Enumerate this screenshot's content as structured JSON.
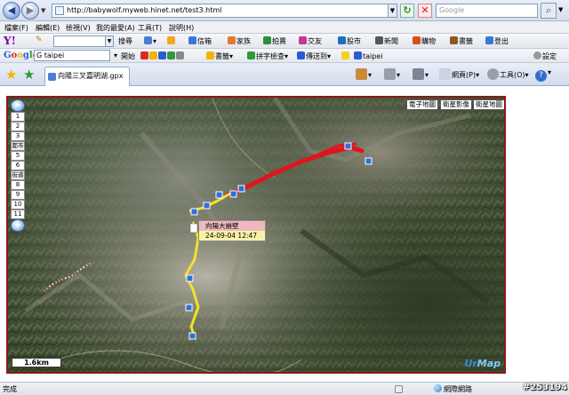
{
  "browser": {
    "url": "http://babywolf.myweb.hinet.net/test3.html",
    "search_placeholder": "Google",
    "nav_back": "◀",
    "nav_forward": "▶",
    "refresh": "↻",
    "stop": "✕",
    "go": "🔍"
  },
  "menu": [
    "檔案(F)",
    "編輯(E)",
    "檢視(V)",
    "我的最愛(A)",
    "工具(T)",
    "說明(H)"
  ],
  "yahoo_toolbar": {
    "logo": "Y!",
    "search_label": "搜尋",
    "items": [
      {
        "label": "信箱",
        "icon": "mail-icon",
        "color": "#3a78d6"
      },
      {
        "label": "家族",
        "icon": "family-icon",
        "color": "#e07b2a"
      },
      {
        "label": "拍賣",
        "icon": "auction-icon",
        "color": "#2d8f3a"
      },
      {
        "label": "交友",
        "icon": "dating-icon",
        "color": "#c33a8f"
      },
      {
        "label": "股市",
        "icon": "stock-icon",
        "color": "#1f6fc0"
      },
      {
        "label": "新聞",
        "icon": "news-icon",
        "color": "#555555"
      },
      {
        "label": "購物",
        "icon": "shopping-icon",
        "color": "#d94f1e"
      },
      {
        "label": "書籤",
        "icon": "bookmark-icon",
        "color": "#8a5a1e"
      },
      {
        "label": "登出",
        "icon": "logout-icon",
        "color": "#3a78d6"
      }
    ]
  },
  "google_toolbar": {
    "logo_letters": [
      "G",
      "o",
      "o",
      "g",
      "l",
      "e"
    ],
    "logo_colors": [
      "#2a5bd7",
      "#d62d20",
      "#f2b400",
      "#2a5bd7",
      "#2e9b3a",
      "#d62d20"
    ],
    "query": "G taipei",
    "go_label": "開始",
    "bookmarks_label": "書籤",
    "spellcheck_label": "拼字檢查",
    "send_label": "傳送到",
    "highlight_term": "taipei",
    "settings_label": "設定"
  },
  "tabs": [
    {
      "label": "向陽三叉嘉明湖.gpx"
    }
  ],
  "tab_toolbar": {
    "page_label": "網頁(P)",
    "tools_label": "工具(O)"
  },
  "map": {
    "type_buttons": [
      "電子地圖",
      "衛星影像",
      "衛星地圖"
    ],
    "zoom_levels": [
      "1",
      "2",
      "3",
      "都市",
      "5",
      "6",
      "街道",
      "8",
      "9",
      "10",
      "11"
    ],
    "tooltip_title": "向陽大崩壁",
    "tooltip_time": "24-09-04 12:47",
    "scale_label": "1.6km",
    "watermark_a": "Ur",
    "watermark_b": "Map"
  },
  "status": {
    "text": "完成",
    "zone": "網際網路"
  },
  "watermark_id": "#253194"
}
